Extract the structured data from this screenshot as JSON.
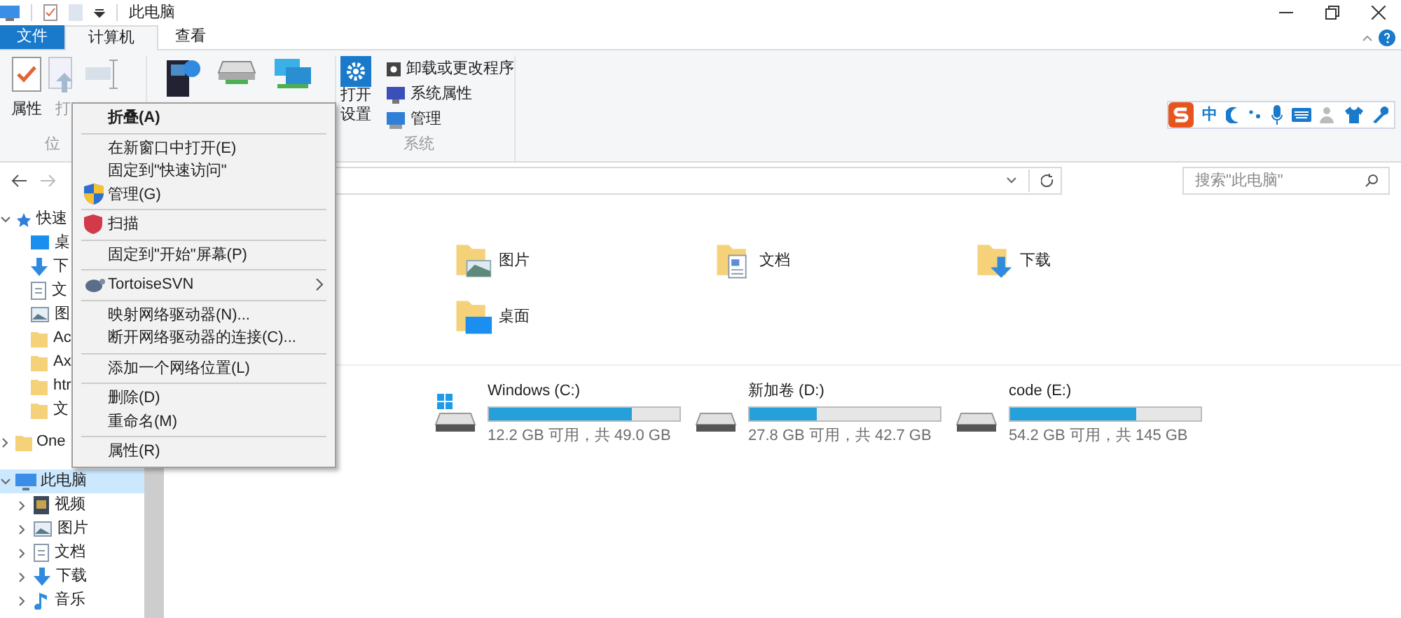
{
  "window": {
    "title": "此电脑"
  },
  "file_menu": {
    "label": "文件"
  },
  "tabs": [
    {
      "label": "计算机",
      "selected": true
    },
    {
      "label": "查看",
      "selected": false
    }
  ],
  "ribbon": {
    "location_items": [
      {
        "label": "属性",
        "kind": "props"
      },
      {
        "label": "打",
        "kind": "open"
      },
      {
        "kind": "rename"
      }
    ],
    "location_group": "位",
    "network_items": [
      {
        "kind": "media"
      },
      {
        "kind": "drive"
      },
      {
        "kind": "network"
      }
    ],
    "settings": {
      "label": "打开",
      "label2": "设置"
    },
    "system_items": [
      {
        "label": "卸载或更改程序",
        "kind": "uninstall"
      },
      {
        "label": "系统属性",
        "kind": "sysprops"
      },
      {
        "label": "管理",
        "kind": "manage"
      }
    ],
    "system_group": "系统"
  },
  "search": {
    "placeholder": "搜索\"此电脑\""
  },
  "sidebar": {
    "items": [
      {
        "label": "快速",
        "kind": "star",
        "expanded": true,
        "selected": false,
        "children": [
          {
            "label": "桌",
            "kind": "desktop"
          },
          {
            "label": "下",
            "kind": "download"
          },
          {
            "label": "文",
            "kind": "doc"
          },
          {
            "label": "图",
            "kind": "pic"
          },
          {
            "label": "Ac",
            "kind": "folder"
          },
          {
            "label": "Ax",
            "kind": "folder"
          },
          {
            "label": "htr",
            "kind": "folder"
          },
          {
            "label": "文",
            "kind": "folder"
          }
        ]
      },
      {
        "label": "One",
        "kind": "folder",
        "expanded": false,
        "selected": false
      },
      {
        "label": "此电脑",
        "kind": "pc",
        "expanded": true,
        "selected": true,
        "children": [
          {
            "label": "视频",
            "kind": "video"
          },
          {
            "label": "图片",
            "kind": "pic"
          },
          {
            "label": "文档",
            "kind": "doc"
          },
          {
            "label": "下载",
            "kind": "download"
          },
          {
            "label": "音乐",
            "kind": "music"
          }
        ]
      }
    ]
  },
  "folders": [
    {
      "label": "图片",
      "kind": "pic"
    },
    {
      "label": "文档",
      "kind": "doc"
    },
    {
      "label": "下载",
      "kind": "download"
    },
    {
      "label": "桌面",
      "kind": "desktop"
    }
  ],
  "drives": [
    {
      "name": "Windows (C:)",
      "kind": "system",
      "level": 0.75,
      "free": "12.2 GB 可用，共 49.0 GB"
    },
    {
      "name": "新加卷 (D:)",
      "kind": "disk",
      "level": 0.35,
      "free": "27.8 GB 可用，共 42.7 GB"
    },
    {
      "name": "code (E:)",
      "kind": "disk",
      "level": 0.66,
      "free": "54.2 GB 可用，共 145 GB"
    }
  ],
  "ime": {
    "label": "中"
  },
  "context_menu": [
    [
      {
        "label": "折叠(A)",
        "kind": "default"
      }
    ],
    [
      {
        "label": "在新窗口中打开(E)",
        "kind": "plain"
      },
      {
        "label": "固定到\"快速访问\"",
        "kind": "plain"
      },
      {
        "label": "管理(G)",
        "kind": "shield"
      }
    ],
    [
      {
        "label": "扫描",
        "kind": "scan"
      }
    ],
    [
      {
        "label": "固定到\"开始\"屏幕(P)",
        "kind": "plain"
      }
    ],
    [
      {
        "label": "TortoiseSVN",
        "kind": "svn_submenu"
      }
    ],
    [
      {
        "label": "映射网络驱动器(N)...",
        "kind": "plain"
      },
      {
        "label": "断开网络驱动器的连接(C)...",
        "kind": "plain"
      }
    ],
    [
      {
        "label": "添加一个网络位置(L)",
        "kind": "plain"
      }
    ],
    [
      {
        "label": "删除(D)",
        "kind": "plain"
      },
      {
        "label": "重命名(M)",
        "kind": "plain"
      }
    ],
    [
      {
        "label": "属性(R)",
        "kind": "plain"
      }
    ]
  ]
}
